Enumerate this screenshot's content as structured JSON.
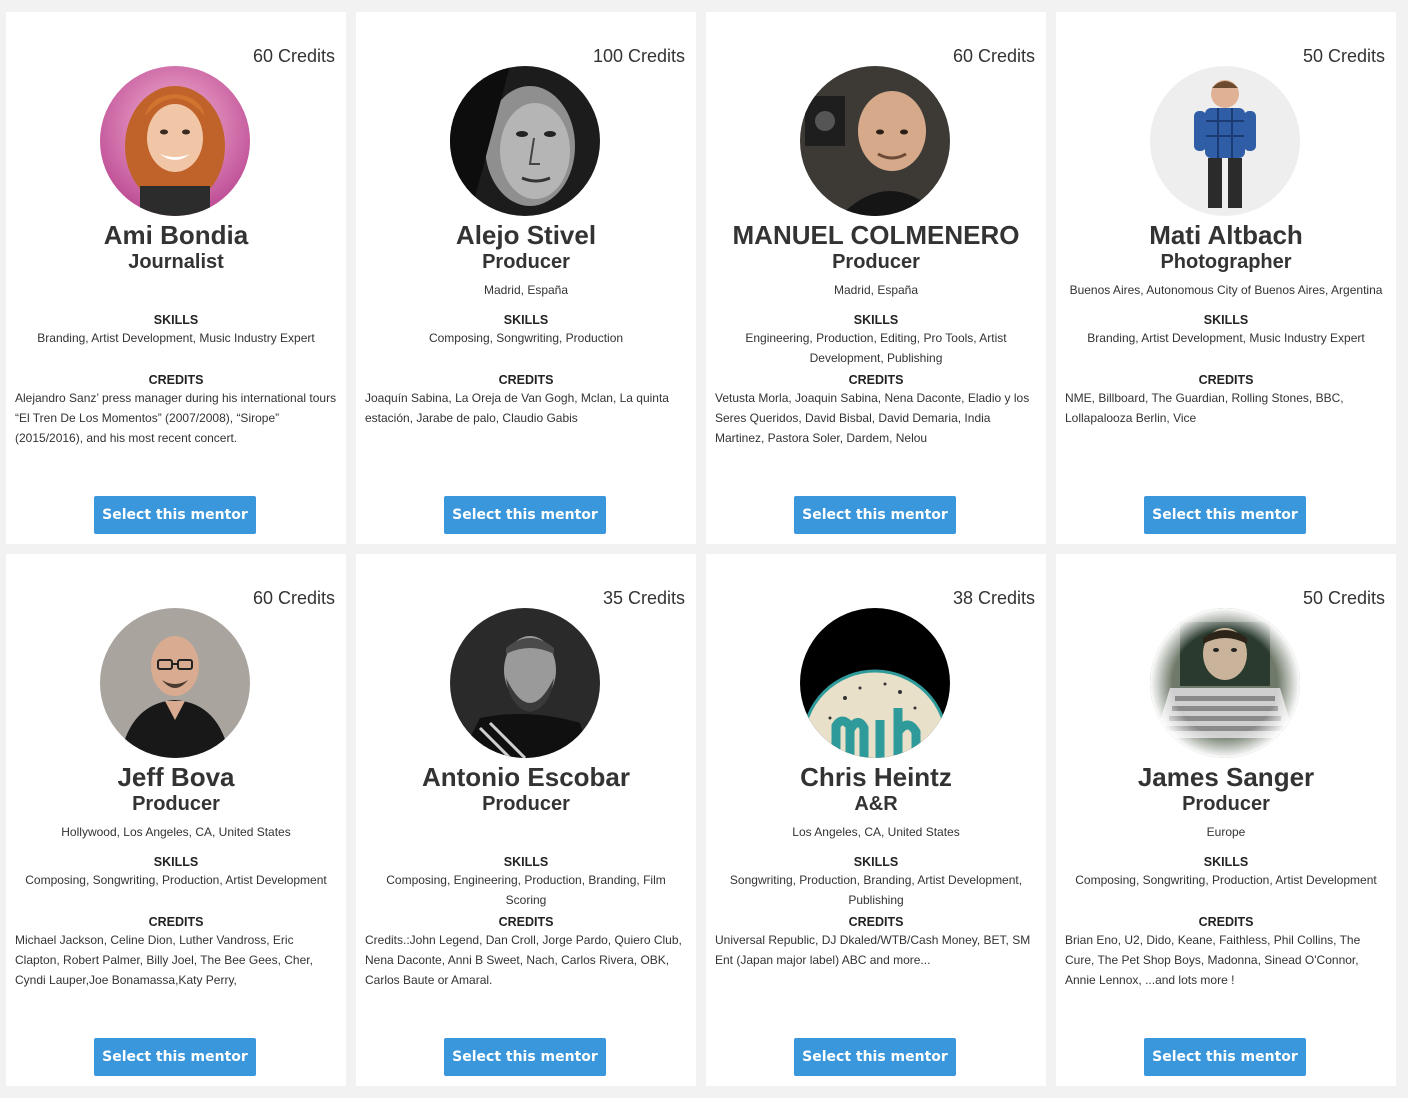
{
  "mentors": [
    {
      "credits_count": "60 Credits",
      "name": "Ami Bondia",
      "role": "Journalist",
      "location": "",
      "skills_title": "SKILLS",
      "skills": "Branding, Artist Development, Music Industry Expert",
      "credits_title": "CREDITS",
      "credits": "Alejandro Sanz’ press manager during his international tours “El Tren De Los Momentos” (2007/2008), “Sirope” (2015/2016), and his most recent concert.",
      "button_label": "Select this mentor",
      "avatar_icon": "woman-red-curly-hair-portrait"
    },
    {
      "credits_count": "100 Credits",
      "name": "Alejo Stivel",
      "role": "Producer",
      "location": "Madrid, España",
      "skills_title": "SKILLS",
      "skills": "Composing, Songwriting, Production",
      "credits_title": "CREDITS",
      "credits": "Joaquín Sabina, La Oreja de Van Gogh, Mclan, La quinta estación, Jarabe de palo, Claudio Gabis",
      "button_label": "Select this mentor",
      "avatar_icon": "man-bw-closeup-portrait"
    },
    {
      "credits_count": "60 Credits",
      "name": "MANUEL COLMENERO",
      "role": "Producer",
      "location": "Madrid, España",
      "skills_title": "SKILLS",
      "skills": "Engineering, Production, Editing, Pro Tools, Artist Development, Publishing",
      "credits_title": "CREDITS",
      "credits": "Vetusta Morla, Joaquin Sabina, Nena Daconte, Eladio y los Seres Queridos, David Bisbal, David Demaria, India Martinez, Pastora Soler, Dardem, Nelou",
      "button_label": "Select this mentor",
      "avatar_icon": "bald-man-studio-portrait"
    },
    {
      "credits_count": "50 Credits",
      "name": "Mati Altbach",
      "role": "Photographer",
      "location": "Buenos Aires, Autonomous City of Buenos Aires, Argentina",
      "skills_title": "SKILLS",
      "skills": "Branding, Artist Development, Music Industry Expert",
      "credits_title": "CREDITS",
      "credits": "NME, Billboard, The Guardian, Rolling Stones, BBC, Lollapalooza Berlin, Vice",
      "button_label": "Select this mentor",
      "avatar_icon": "man-plaid-shirt-full-body"
    },
    {
      "credits_count": "60 Credits",
      "name": "Jeff Bova",
      "role": "Producer",
      "location": "Hollywood, Los Angeles, CA, United States",
      "skills_title": "SKILLS",
      "skills": "Composing, Songwriting, Production, Artist Development",
      "credits_title": "CREDITS",
      "credits": "Michael Jackson, Celine Dion, Luther Vandross, Eric Clapton, Robert Palmer, Billy Joel, The Bee Gees, Cher, Cyndi Lauper,Joe Bonamassa,Katy Perry,",
      "button_label": "Select this mentor",
      "avatar_icon": "man-glasses-black-shirt-portrait"
    },
    {
      "credits_count": "35 Credits",
      "name": "Antonio Escobar",
      "role": "Producer",
      "location": "",
      "skills_title": "SKILLS",
      "skills": "Composing, Engineering, Production, Branding, Film Scoring",
      "credits_title": "CREDITS",
      "credits": "Credits.:John Legend, Dan Croll, Jorge Pardo, Quiero Club, Nena Daconte, Anni B Sweet, Nach, Carlos Rivera, OBK, Carlos Baute or Amaral.",
      "button_label": "Select this mentor",
      "avatar_icon": "bearded-man-bw-portrait"
    },
    {
      "credits_count": "38 Credits",
      "name": "Chris Heintz",
      "role": "A&R",
      "location": "Los Angeles, CA, United States",
      "skills_title": "SKILLS",
      "skills": "Songwriting, Production, Branding, Artist Development, Publishing",
      "credits_title": "CREDITS",
      "credits": "Universal Republic, DJ Dkaled/WTB/Cash Money, BET, SM Ent (Japan major label) ABC and more...",
      "button_label": "Select this mentor",
      "avatar_icon": "logo-badge-image"
    },
    {
      "credits_count": "50 Credits",
      "name": "James Sanger",
      "role": "Producer",
      "location": "Europe",
      "skills_title": "SKILLS",
      "skills": "Composing, Songwriting, Production, Artist Development",
      "credits_title": "CREDITS",
      "credits": "Brian Eno, U2, Dido, Keane, Faithless, Phil Collins, The Cure, The Pet Shop Boys, Madonna, Sinead O'Connor, Annie Lennox, ...and lots more !",
      "button_label": "Select this mentor",
      "avatar_icon": "man-behind-laptop-image"
    }
  ],
  "colors": {
    "page_background": "#f2f2f2",
    "card_background": "#ffffff",
    "button_background": "#3a97dc",
    "button_text": "#ffffff",
    "text": "#333333"
  }
}
